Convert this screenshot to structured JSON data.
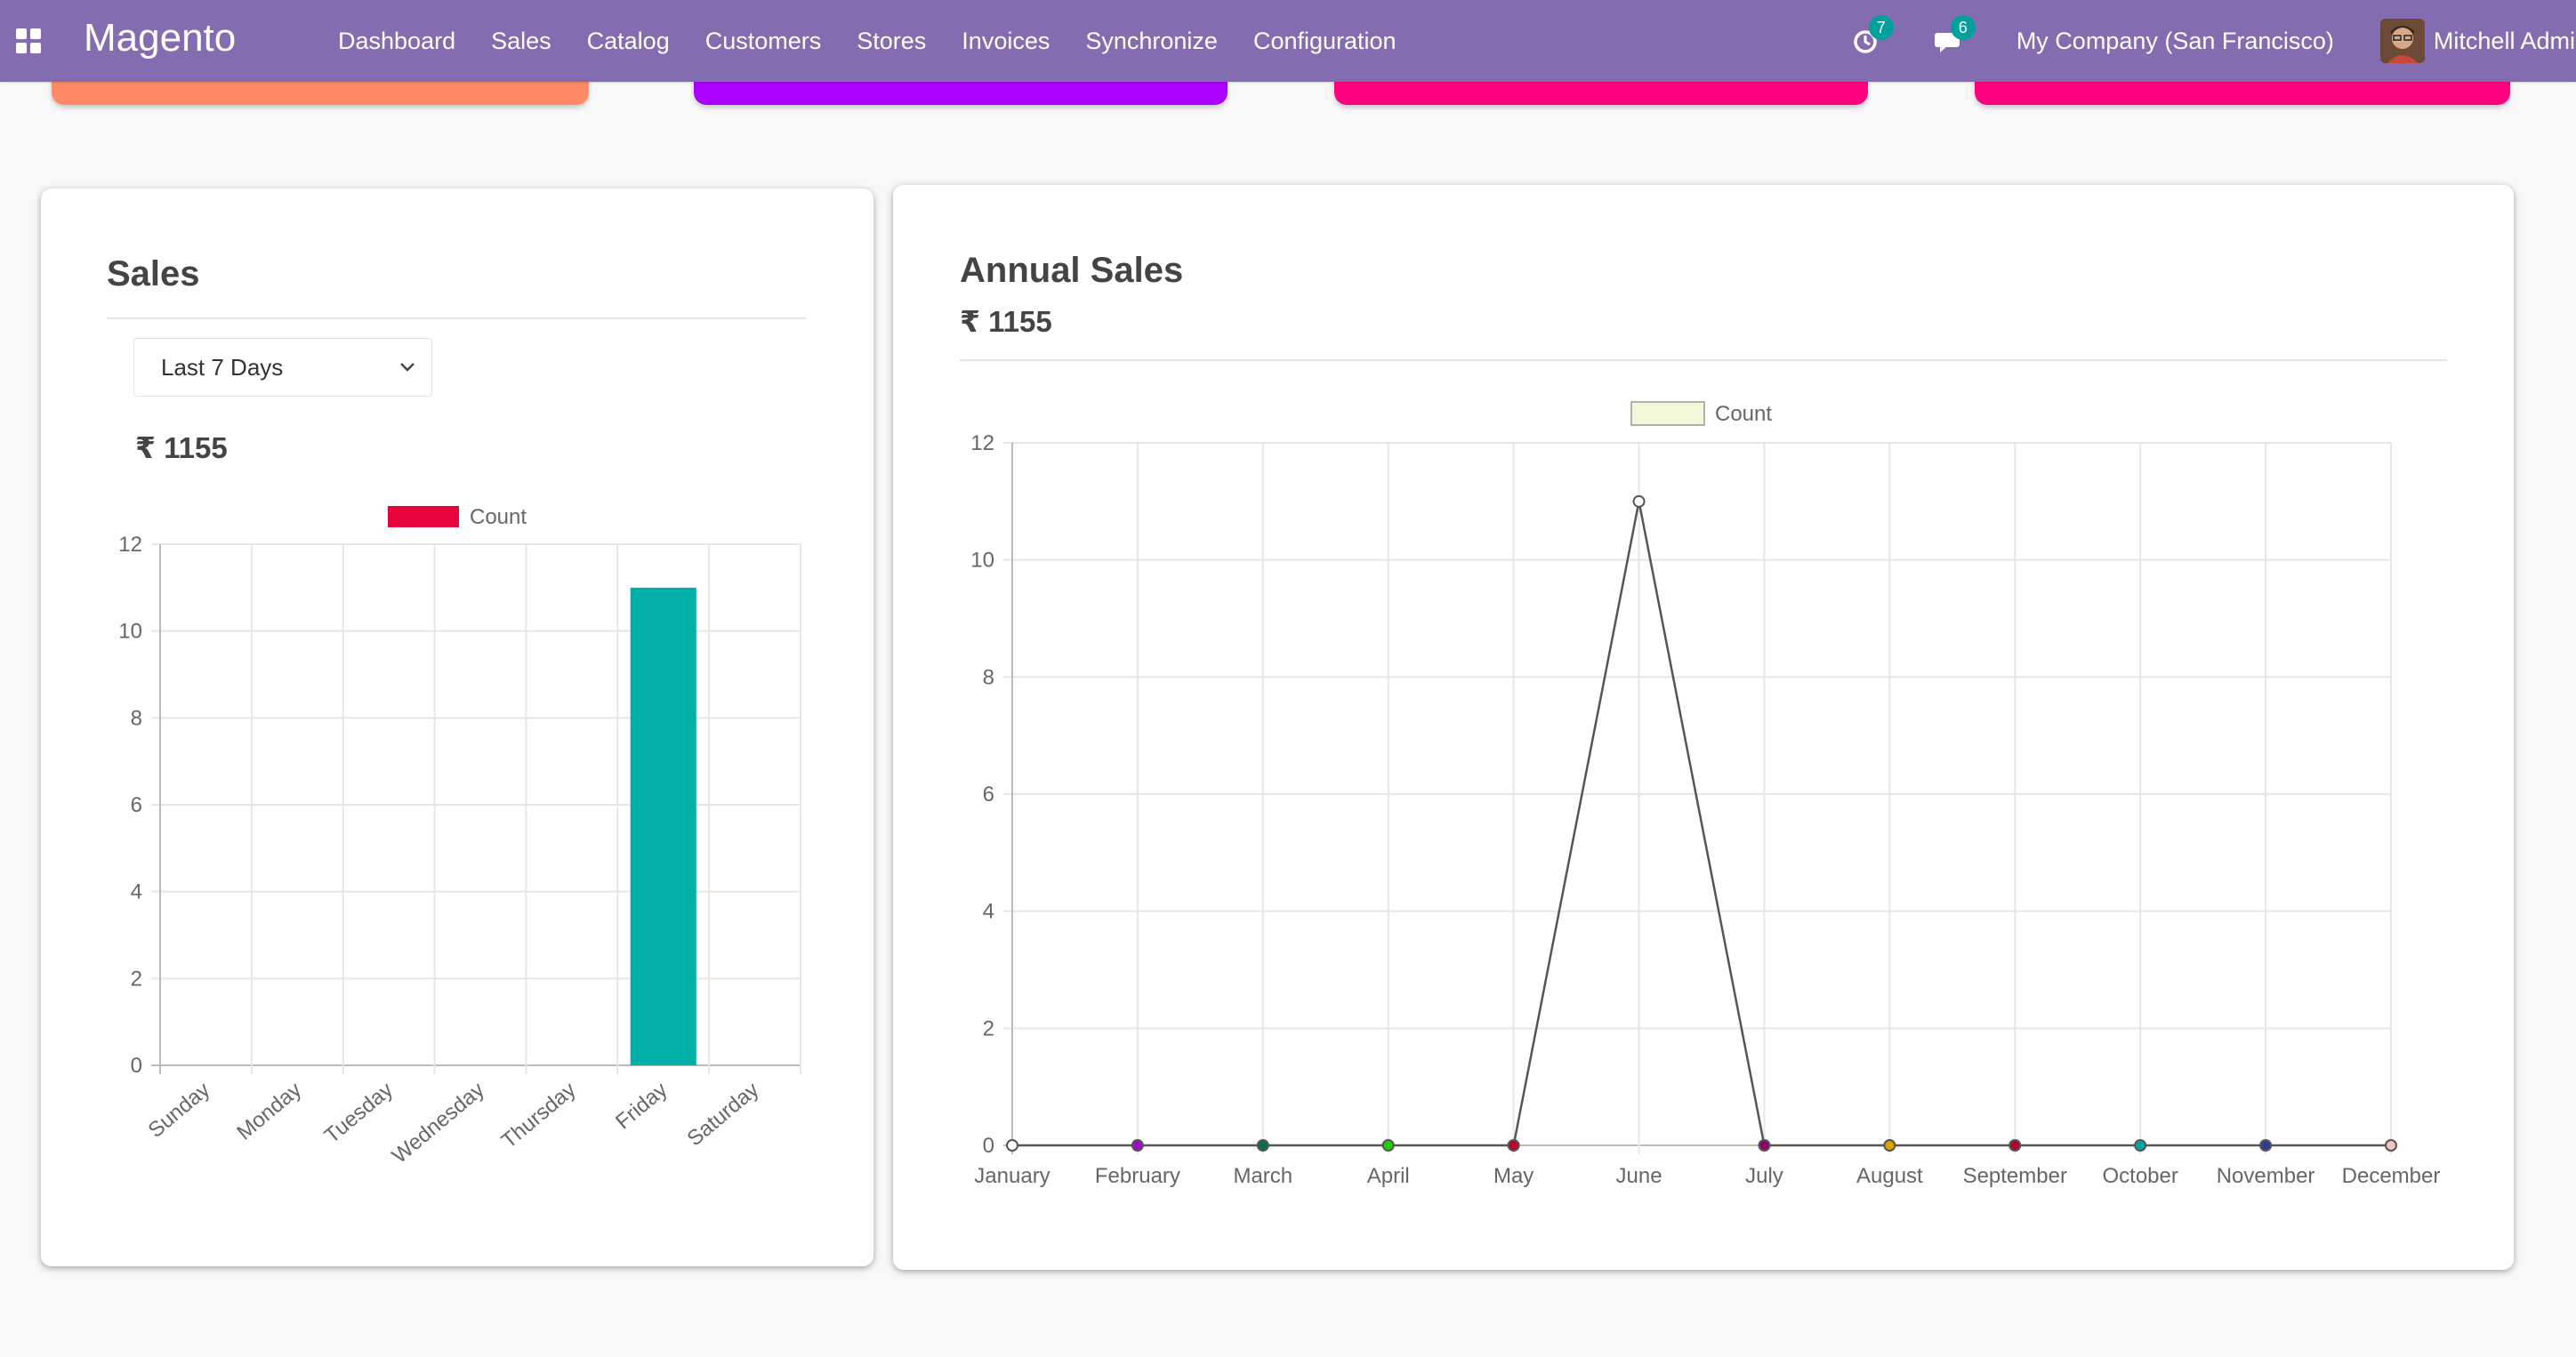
{
  "navbar": {
    "brand": "Magento",
    "menu": [
      "Dashboard",
      "Sales",
      "Catalog",
      "Customers",
      "Stores",
      "Invoices",
      "Synchronize",
      "Configuration"
    ],
    "activity_badge": "7",
    "messages_badge": "6",
    "company": "My Company (San Francisco)",
    "user": "Mitchell Admin",
    "bg_color": "#836caf"
  },
  "top_cards": [
    {
      "color": "#ff8a65"
    },
    {
      "color": "#aa00ff"
    },
    {
      "color": "#ff0080"
    },
    {
      "color": "#ff0080"
    }
  ],
  "sales_panel": {
    "title": "Sales",
    "period_select": "Last 7 Days",
    "amount": "₹ 1155"
  },
  "annual_panel": {
    "title": "Annual Sales",
    "amount": "₹ 1155"
  },
  "chart_data": [
    {
      "type": "bar",
      "legend": [
        "Count"
      ],
      "legend_color": "#e8053d",
      "categories": [
        "Sunday",
        "Monday",
        "Tuesday",
        "Wednesday",
        "Thursday",
        "Friday",
        "Saturday"
      ],
      "series": [
        {
          "name": "Count",
          "values": [
            0,
            0,
            0,
            0,
            0,
            11,
            0
          ],
          "color": "#00b0a8"
        }
      ],
      "yticks": [
        "0",
        "2",
        "4",
        "6",
        "8",
        "10",
        "12"
      ],
      "ylim": [
        0,
        12
      ],
      "grid": true,
      "legend_position": "top"
    },
    {
      "type": "line",
      "legend": [
        "Count"
      ],
      "legend_color": "#f3f8d8",
      "categories": [
        "January",
        "February",
        "March",
        "April",
        "May",
        "June",
        "July",
        "August",
        "September",
        "October",
        "November",
        "December"
      ],
      "series": [
        {
          "name": "Count",
          "values": [
            0,
            0,
            0,
            0,
            0,
            11,
            0,
            0,
            0,
            0,
            0,
            0
          ],
          "color": "#555555"
        }
      ],
      "point_colors": [
        "#ffffff",
        "#9b0fc4",
        "#0b6b4b",
        "#22d000",
        "#c4002c",
        "#ffffff",
        "#8a006e",
        "#d9a400",
        "#b3002c",
        "#00a6a0",
        "#2b3f8c",
        "#f0c2c0"
      ],
      "yticks": [
        "0",
        "2",
        "4",
        "6",
        "8",
        "10",
        "12"
      ],
      "ylim": [
        0,
        12
      ],
      "grid": true,
      "legend_position": "top"
    }
  ]
}
